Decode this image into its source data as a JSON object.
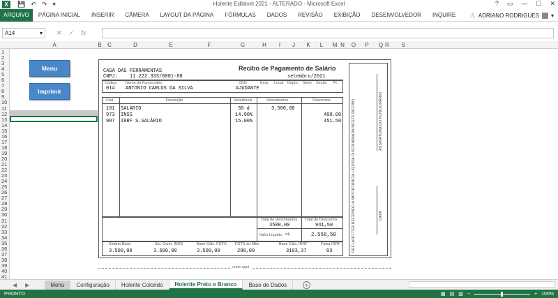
{
  "window": {
    "title": "Holerite Editável 2021 - ALTERADO - Microsoft Excel",
    "app_icon": "X"
  },
  "qat": {
    "save": "💾",
    "undo": "↶",
    "redo": "↷",
    "customize": "▾"
  },
  "winctl": {
    "help": "?",
    "ribbon_opts": "▭",
    "minimize": "—",
    "maximize": "☐",
    "close": "✕"
  },
  "ribbon": {
    "file": "ARQUIVO",
    "tabs": [
      "PÁGINA INICIAL",
      "INSERIR",
      "CÂMERA",
      "LAYOUT DA PÁGINA",
      "FÓRMULAS",
      "DADOS",
      "REVISÃO",
      "EXIBIÇÃO",
      "DESENVOLVEDOR",
      "INQUIRE"
    ],
    "user": "ADRIANO RODRIGUES",
    "user_arrow": "▾"
  },
  "formula_bar": {
    "name_box": "A14",
    "name_arrow": "▾",
    "fx_icons": [
      "✕",
      "✓",
      "fx"
    ],
    "value": ""
  },
  "columns": [
    "A",
    "B",
    "C",
    "D",
    "E",
    "F",
    "G",
    "H",
    "I",
    "J",
    "K",
    "L",
    "M",
    "N",
    "O",
    "P",
    "Q",
    "R",
    "S"
  ],
  "rows": [
    "1",
    "2",
    "3",
    "4",
    "5",
    "6",
    "7",
    "8",
    "9",
    "10",
    "11",
    "12",
    "13",
    "14",
    "15",
    "16",
    "17",
    "18",
    "19",
    "20",
    "21",
    "22",
    "23",
    "24",
    "25",
    "26",
    "27",
    "28",
    "29",
    "30",
    "31",
    "32",
    "33",
    "34",
    "35",
    "36",
    "37",
    "38",
    "39",
    "40",
    "41"
  ],
  "buttons": {
    "menu": "Menu",
    "print": "Imprimir"
  },
  "receipt": {
    "company": "CASA DAS FERRAMENTAS",
    "cnpj_label": "CNPJ:",
    "cnpj": "11.222.333/0001-88",
    "title": "Recibo de Pagamento de Salário",
    "period": "setembro/2021",
    "labels": {
      "code": "Código",
      "name": "Nome do Funcionário",
      "cbo": "CBO",
      "emp": "Emp.",
      "local": "Local",
      "dept": "Depto.",
      "setor": "Setor",
      "secao": "Seção",
      "fl": "Fl."
    },
    "employee": {
      "code": "014",
      "name": "ANTONIO CARLOS DA SILVA",
      "role": "AJUDANTE"
    },
    "table_headers": {
      "cod": "Cód.",
      "desc": "Descrição",
      "ref": "Referência",
      "venc": "Vencimentos",
      "desc_total": "Descontos"
    },
    "items": [
      {
        "cod": "101",
        "desc": "SALÁRIO",
        "ref": "30 d",
        "venc": "3.500,00",
        "descv": ""
      },
      {
        "cod": "973",
        "desc": "INSS",
        "ref": "14.00%",
        "venc": "",
        "descv": "490.00"
      },
      {
        "cod": "987",
        "desc": "IRRF S.SALÁRIO",
        "ref": "15.00%",
        "venc": "",
        "descv": "451.50"
      }
    ],
    "totals": {
      "venc_label": "Total de Vencimentos",
      "venc": "3500,00",
      "desc_label": "Total de Descontos",
      "desc": "941,50",
      "net_label": "Valor Líquido",
      "net_arrow": "⇨",
      "net": "2.558,50"
    },
    "footer": {
      "labels": [
        "Salário Base",
        "Sal. Contr. INSS",
        "Base Cálc. FGTS",
        "FGTS do Mês",
        "Base Cálc. IRRF",
        "Faixa IRRF"
      ],
      "values": [
        "3.500,00",
        "3.500,00",
        "3.500,00",
        "280,00",
        "3103,37",
        "03"
      ]
    },
    "side": {
      "declaro": "DECLARO TER RECEBIDO A IMPORTÂNCIA LÍQUIDA DISCRIMINADA NESTE RECIBO",
      "assinatura": "ASSINATURA DO FUNCIONÁRIO",
      "data": "DATA"
    },
    "cut": "corte aqui"
  },
  "sheets": {
    "nav": [
      "◀",
      "▶"
    ],
    "tabs": [
      "Menu",
      "Configuração",
      "Holerite Colorido",
      "Holerite Preto e Branco",
      "Base de Dados"
    ],
    "add": "+",
    "more": "…"
  },
  "status": {
    "ready": "PRONTO",
    "zoom": "100%",
    "zoom_minus": "−",
    "zoom_plus": "+",
    "view_icons": [
      "▦",
      "▤",
      "▥"
    ]
  }
}
